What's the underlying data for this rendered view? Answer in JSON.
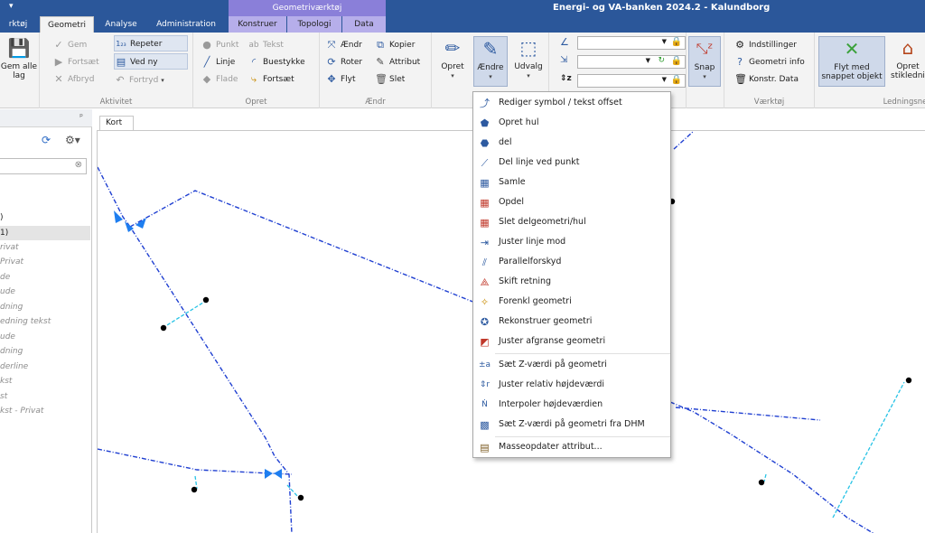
{
  "titlebar": {
    "qat": "▾",
    "context_band": "Geometriværktøj",
    "app_title": "Energi- og VA-banken 2024.2 - Kalundborg"
  },
  "tabs": [
    {
      "label": "rktøj"
    },
    {
      "label": "Geometri"
    },
    {
      "label": "Analyse"
    },
    {
      "label": "Administration"
    },
    {
      "label": "Konstruer"
    },
    {
      "label": "Topologi"
    },
    {
      "label": "Data"
    }
  ],
  "ribbon": {
    "gem_alle": "Gem alle lag",
    "aktivitet": {
      "label": "Aktivitet",
      "gem": "Gem",
      "fortsaet": "Fortsæt",
      "afbryd": "Afbryd",
      "repeter": "Repeter",
      "ved_ny": "Ved ny",
      "fortryd": "Fortryd"
    },
    "opret": {
      "label": "Opret",
      "punkt": "Punkt",
      "tekst": "Tekst",
      "linje": "Linje",
      "buestykke": "Buestykke",
      "flade": "Flade",
      "fortsaet": "Fortsæt"
    },
    "aendr": {
      "label": "Ændr",
      "aendr": "Ændr",
      "kopier": "Kopier",
      "roter": "Roter",
      "attribut": "Attribut",
      "flyt": "Flyt",
      "slet": "Slet"
    },
    "big": {
      "opret": "Opret",
      "aendre": "Ændre",
      "udvalg": "Udvalg",
      "snap": "Snap"
    },
    "vaerktoj": {
      "label": "Værktøj",
      "indstillinger": "Indstillinger",
      "geometri_info": "Geometri info",
      "konstr_data": "Konstr. Data"
    },
    "ledning": {
      "label": "Ledningsne",
      "flyt_med": "Flyt med snappet objekt",
      "opret_stik": "Opret stikledni"
    }
  },
  "leftpanel": {
    "pin": "ᵖ",
    "items": [
      {
        "label": ")"
      },
      {
        "label": "1)"
      },
      {
        "label": "rivat"
      },
      {
        "label": "Privat"
      },
      {
        "label": "de"
      },
      {
        "label": "ude"
      },
      {
        "label": "dning"
      },
      {
        "label": "edning tekst"
      },
      {
        "label": "ude"
      },
      {
        "label": "dning"
      },
      {
        "label": "derline"
      },
      {
        "label": "kst"
      },
      {
        "label": "st"
      },
      {
        "label": "kst - Privat"
      }
    ]
  },
  "map": {
    "tab_label": "Kort"
  },
  "menu": {
    "items": [
      {
        "label": "Rediger symbol / tekst offset"
      },
      {
        "label": "Opret hul"
      },
      {
        "label": "del"
      },
      {
        "label": "Del linje ved punkt"
      },
      {
        "label": "Samle"
      },
      {
        "label": "Opdel"
      },
      {
        "label": "Slet delgeometri/hul"
      },
      {
        "label": "Juster linje mod"
      },
      {
        "label": "Parallelforskyd"
      },
      {
        "label": "Skift retning"
      },
      {
        "label": "Forenkl geometri"
      },
      {
        "label": "Rekonstruer geometri"
      },
      {
        "label": "Juster afgranse geometri"
      },
      {
        "label": "Sæt Z-værdi på geometri"
      },
      {
        "label": "Juster relativ højdeværdi"
      },
      {
        "label": "Interpoler højdeværdien"
      },
      {
        "label": "Sæt Z-værdi på geometri fra DHM"
      },
      {
        "label": "Masseopdater attribut..."
      }
    ]
  },
  "colors": {
    "title_blue": "#2b579a",
    "context_purple": "#8a7fd9",
    "line_blue": "#1f3fd1",
    "line_cyan": "#27c3e6"
  }
}
